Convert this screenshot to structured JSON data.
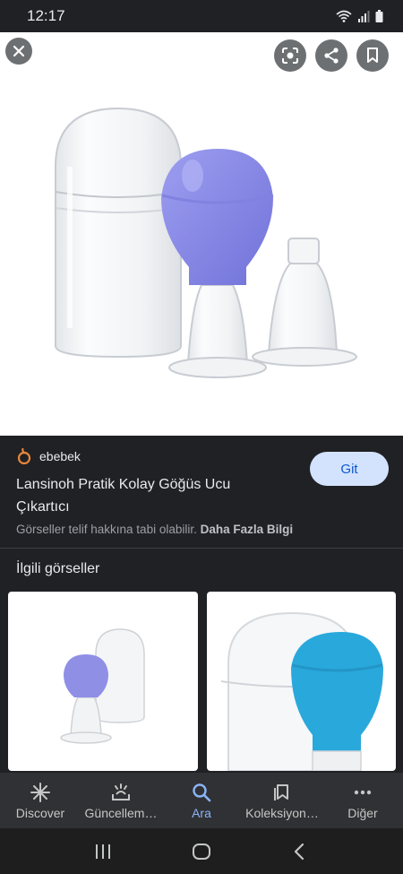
{
  "status_bar": {
    "time": "12:17"
  },
  "source": {
    "name": "ebebek"
  },
  "result": {
    "title": "Lansinoh Pratik Kolay Göğüs Ucu Çıkartıcı",
    "visit_label": "Git",
    "copyright_text": "Görseller telif hakkına tabi olabilir.",
    "learn_more_label": "Daha Fazla Bilgi"
  },
  "related": {
    "heading": "İlgili görseller"
  },
  "bottom_nav": {
    "items": [
      {
        "label": "Discover",
        "icon": "asterisk-icon"
      },
      {
        "label": "Güncellem…",
        "icon": "updates-icon"
      },
      {
        "label": "Ara",
        "icon": "search-icon"
      },
      {
        "label": "Koleksiyon…",
        "icon": "collections-icon"
      },
      {
        "label": "Diğer",
        "icon": "more-icon"
      }
    ],
    "active_index": 2
  },
  "colors": {
    "accent": "#8ab4f8",
    "background": "#202124",
    "button": "#d3e3fd"
  }
}
